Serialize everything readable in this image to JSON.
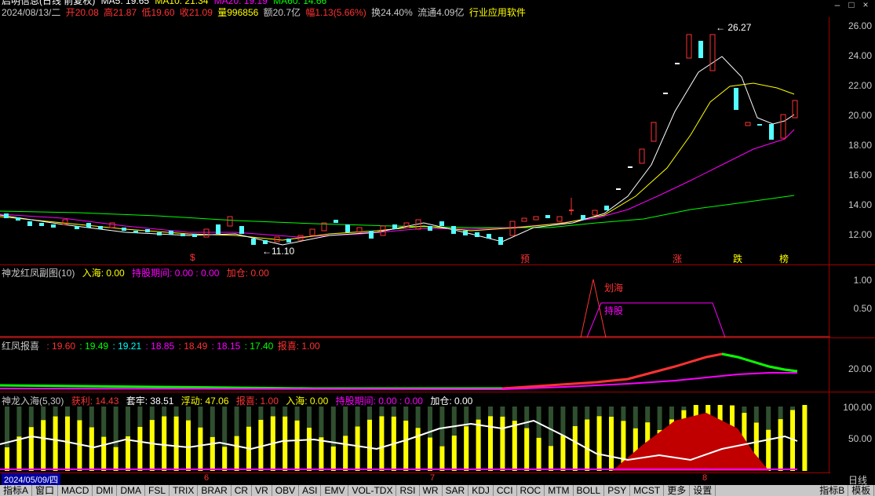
{
  "header": {
    "title": "启明信息(日线 前复权)",
    "ma": [
      {
        "label": "MA5: 19.65",
        "color": "#ffffff"
      },
      {
        "label": "MA10: 21.34",
        "color": "#ffff00"
      },
      {
        "label": "MA20: 19.19",
        "color": "#ff00ff"
      },
      {
        "label": "MA60: 14.66",
        "color": "#00ff00"
      }
    ],
    "date": "2024/08/13/二",
    "open": "开20.08",
    "high": "高21.87",
    "low": "低19.60",
    "close": "收21.09",
    "volume": "量996856",
    "amount": "额20.7亿",
    "change": "幅1.13(5.66%)",
    "turnover": "换24.40%",
    "float": "流通4.09亿",
    "industry": "行业应用软件"
  },
  "colors": {
    "up": "#ff3232",
    "down": "#54ffff",
    "ma5": "#ffffff",
    "ma10": "#ffff00",
    "ma20": "#ff00ff",
    "ma60": "#00ff00",
    "grid": "#a00000"
  },
  "price_axis": [
    "26.00",
    "24.00",
    "22.00",
    "20.00",
    "18.00",
    "16.00",
    "14.00",
    "12.00"
  ],
  "annotations": {
    "high_label": "26.27",
    "low_label": "11.10",
    "markers": [
      {
        "text": "$",
        "color": "#ff3232"
      },
      {
        "text": "预",
        "color": "#ff3232"
      },
      {
        "text": "涨",
        "color": "#ff3232"
      },
      {
        "text": "跌",
        "color": "#ffff00"
      },
      {
        "text": "榜",
        "color": "#ffff00"
      }
    ]
  },
  "panel1": {
    "name": "神龙红凤副图(10)",
    "items": [
      {
        "label": "入海: 0.00",
        "color": "#ffff00"
      },
      {
        "label": "持股期间: 0.00 : 0.00",
        "color": "#ff00ff"
      },
      {
        "label": "加仓: 0.00",
        "color": "#ff3232"
      }
    ],
    "axis": [
      "1.00",
      "0.50"
    ],
    "labels": [
      "划海",
      "持股"
    ]
  },
  "panel2": {
    "name": "红凤报喜",
    "items": [
      {
        "label": ": 19.60",
        "color": "#ff3232"
      },
      {
        "label": ": 19.49",
        "color": "#00ff00"
      },
      {
        "label": ": 19.21",
        "color": "#00ffff"
      },
      {
        "label": ": 18.85",
        "color": "#ff00ff"
      },
      {
        "label": ": 18.49",
        "color": "#ff3232"
      },
      {
        "label": ": 18.15",
        "color": "#ff00ff"
      },
      {
        "label": ": 17.40",
        "color": "#00ff00"
      },
      {
        "label": "报喜: 1.00",
        "color": "#ff3232"
      }
    ],
    "axis": [
      "20.00"
    ]
  },
  "panel3": {
    "name": "神龙入海(5,30)",
    "items": [
      {
        "label": "获利: 14.43",
        "color": "#ff3232"
      },
      {
        "label": "套牢: 38.51",
        "color": "#ffffff"
      },
      {
        "label": "浮动: 47.06",
        "color": "#ffff00"
      },
      {
        "label": "报喜: 1.00",
        "color": "#ff3232"
      },
      {
        "label": "入海: 0.00",
        "color": "#ffff00"
      },
      {
        "label": "持股期间: 0.00 : 0.00",
        "color": "#ff00ff"
      },
      {
        "label": "加仓: 0.00",
        "color": "#ffffff"
      }
    ],
    "axis": [
      "100.00",
      "50.00"
    ]
  },
  "date_bar": {
    "start": "2024/05/09/四",
    "months": [
      "6",
      "7",
      "8"
    ],
    "period": "日线"
  },
  "tabs": [
    "指标A",
    "窗口",
    "MACD",
    "DMI",
    "DMA",
    "FSL",
    "TRIX",
    "BRAR",
    "CR",
    "VR",
    "OBV",
    "ASI",
    "EMV",
    "VOL-TDX",
    "RSI",
    "WR",
    "SAR",
    "KDJ",
    "CCI",
    "ROC",
    "MTM",
    "BOLL",
    "PSY",
    "MCST",
    "更多",
    "设置"
  ],
  "right_tabs": [
    "指标B",
    "模板"
  ]
}
